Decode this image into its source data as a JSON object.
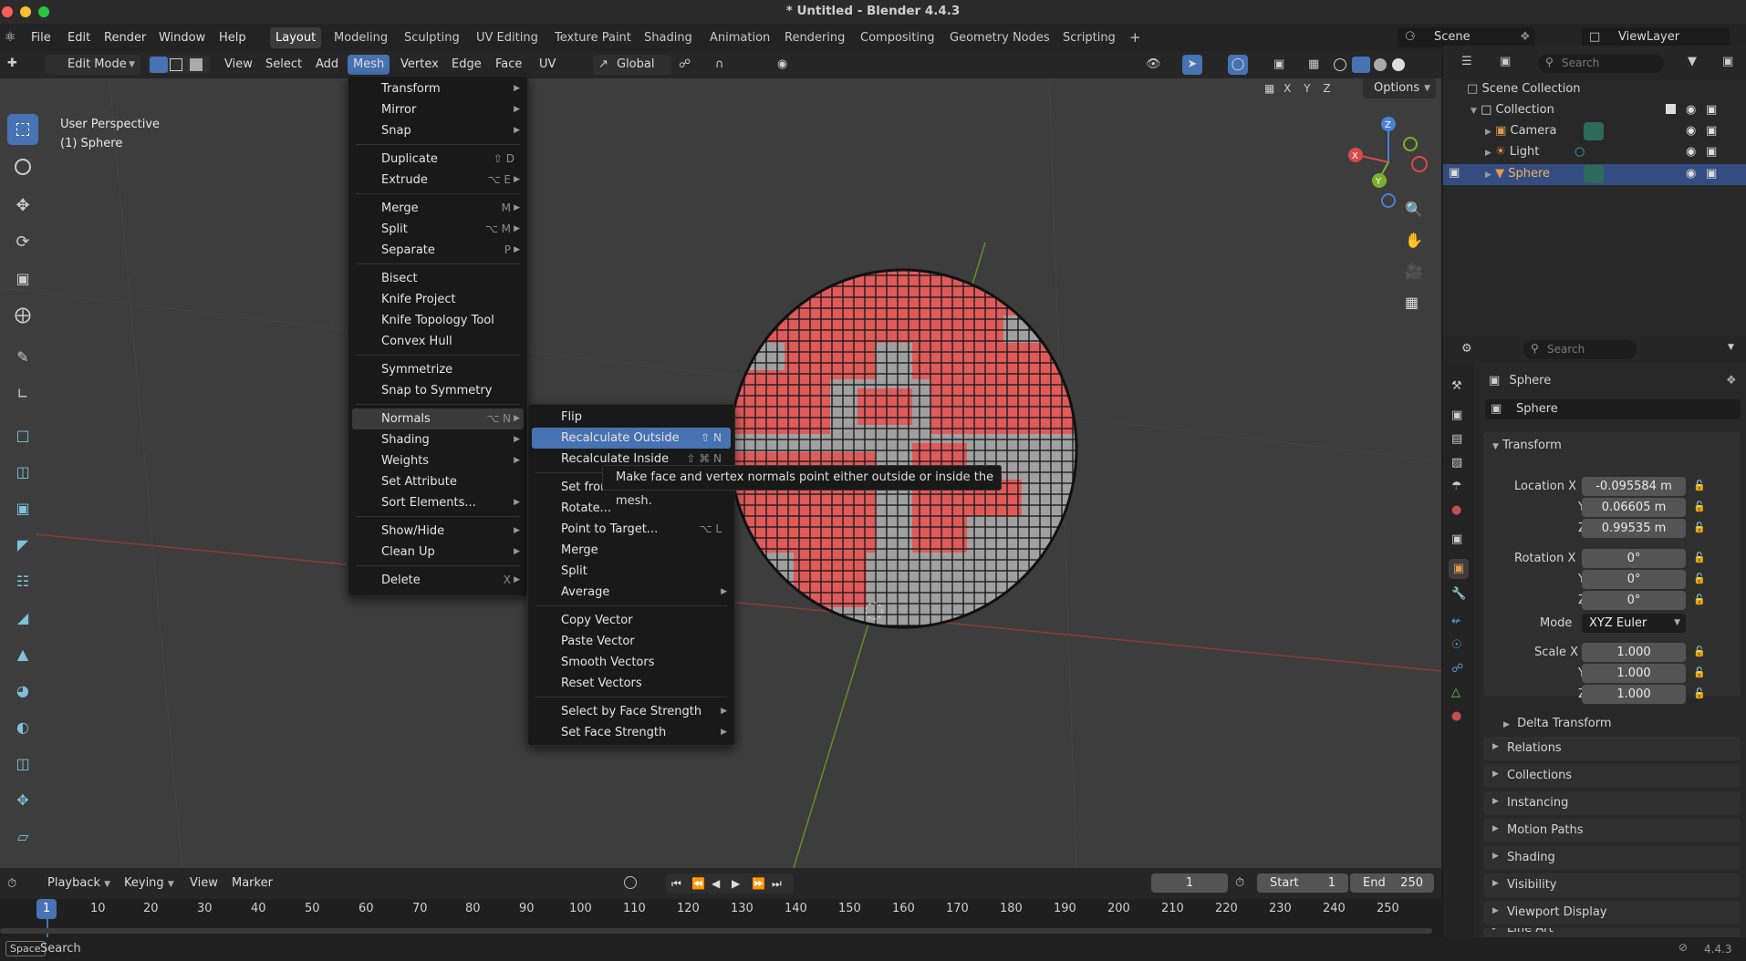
{
  "window": {
    "title": "* Untitled - Blender 4.4.3"
  },
  "menubar": {
    "items": [
      "File",
      "Edit",
      "Render",
      "Window",
      "Help"
    ],
    "workspaces": [
      "Layout",
      "Modeling",
      "Sculpting",
      "UV Editing",
      "Texture Paint",
      "Shading",
      "Animation",
      "Rendering",
      "Compositing",
      "Geometry Nodes",
      "Scripting"
    ],
    "add_tab": "+",
    "scene": "Scene",
    "view_layer": "ViewLayer"
  },
  "viewport_header": {
    "mode": "Edit Mode",
    "menus": [
      "View",
      "Select",
      "Add",
      "Mesh",
      "Vertex",
      "Edge",
      "Face",
      "UV"
    ],
    "orientation": "Global",
    "options": "Options",
    "axes": [
      "X",
      "Y",
      "Z"
    ]
  },
  "viewport": {
    "perspective": "User Perspective",
    "object": "(1) Sphere",
    "gizmo": {
      "z": "Z",
      "y": "Y",
      "x": "X"
    }
  },
  "mesh_menu": {
    "items": [
      {
        "label": "Transform",
        "shortcut": "",
        "sub": true
      },
      {
        "label": "Mirror",
        "shortcut": "",
        "sub": true
      },
      {
        "label": "Snap",
        "shortcut": "",
        "sub": true
      },
      {
        "label": "Duplicate",
        "shortcut": "⇧ D",
        "sub": false
      },
      {
        "label": "Extrude",
        "shortcut": "⌥ E",
        "sub": true
      },
      {
        "label": "Merge",
        "shortcut": "M",
        "sub": true
      },
      {
        "label": "Split",
        "shortcut": "⌥ M",
        "sub": true
      },
      {
        "label": "Separate",
        "shortcut": "P",
        "sub": true
      },
      {
        "label": "Bisect",
        "shortcut": "",
        "sub": false
      },
      {
        "label": "Knife Project",
        "shortcut": "",
        "sub": false
      },
      {
        "label": "Knife Topology Tool",
        "shortcut": "",
        "sub": false
      },
      {
        "label": "Convex Hull",
        "shortcut": "",
        "sub": false
      },
      {
        "label": "Symmetrize",
        "shortcut": "",
        "sub": false
      },
      {
        "label": "Snap to Symmetry",
        "shortcut": "",
        "sub": false
      },
      {
        "label": "Normals",
        "shortcut": "⌥ N",
        "sub": true
      },
      {
        "label": "Shading",
        "shortcut": "",
        "sub": true
      },
      {
        "label": "Weights",
        "shortcut": "",
        "sub": true
      },
      {
        "label": "Set Attribute",
        "shortcut": "",
        "sub": false
      },
      {
        "label": "Sort Elements...",
        "shortcut": "",
        "sub": true
      },
      {
        "label": "Show/Hide",
        "shortcut": "",
        "sub": true
      },
      {
        "label": "Clean Up",
        "shortcut": "",
        "sub": true
      },
      {
        "label": "Delete",
        "shortcut": "X",
        "sub": true
      }
    ]
  },
  "normals_menu": {
    "items": [
      {
        "label": "Flip",
        "shortcut": "",
        "sub": false
      },
      {
        "label": "Recalculate Outside",
        "shortcut": "⇧ N",
        "sub": false
      },
      {
        "label": "Recalculate Inside",
        "shortcut": "⇧ ⌘ N",
        "sub": false
      },
      {
        "label": "Set from Faces",
        "shortcut": "",
        "sub": false
      },
      {
        "label": "Rotate...",
        "shortcut": "",
        "sub": false
      },
      {
        "label": "Point to Target...",
        "shortcut": "⌥ L",
        "sub": false
      },
      {
        "label": "Merge",
        "shortcut": "",
        "sub": false
      },
      {
        "label": "Split",
        "shortcut": "",
        "sub": false
      },
      {
        "label": "Average",
        "shortcut": "",
        "sub": true
      },
      {
        "label": "Copy Vector",
        "shortcut": "",
        "sub": false
      },
      {
        "label": "Paste Vector",
        "shortcut": "",
        "sub": false
      },
      {
        "label": "Smooth Vectors",
        "shortcut": "",
        "sub": false
      },
      {
        "label": "Reset Vectors",
        "shortcut": "",
        "sub": false
      },
      {
        "label": "Select by Face Strength",
        "shortcut": "",
        "sub": true
      },
      {
        "label": "Set Face Strength",
        "shortcut": "",
        "sub": true
      }
    ]
  },
  "tooltip": "Make face and vertex normals point either outside or inside the mesh.",
  "outliner": {
    "search_placeholder": "Search",
    "root": "Scene Collection",
    "collection": "Collection",
    "objects": [
      "Camera",
      "Light",
      "Sphere"
    ]
  },
  "properties": {
    "search_placeholder": "Search",
    "object_name": "Sphere",
    "object_field": "Sphere",
    "transform_label": "Transform",
    "location_label": "Location X",
    "location": [
      "-0.095584 m",
      "0.06605 m",
      "0.99535 m"
    ],
    "rotation_label": "Rotation X",
    "rotation": [
      "0°",
      "0°",
      "0°"
    ],
    "mode_label": "Mode",
    "mode": "XYZ Euler",
    "scale_label": "Scale X",
    "scale": [
      "1.000",
      "1.000",
      "1.000"
    ],
    "axis_y": "Y",
    "axis_z": "Z",
    "panels": [
      "Delta Transform",
      "Relations",
      "Collections",
      "Instancing",
      "Motion Paths",
      "Shading",
      "Visibility",
      "Viewport Display",
      "Line Art"
    ]
  },
  "timeline": {
    "menus": [
      "Playback",
      "Keying",
      "View",
      "Marker"
    ],
    "current_frame": "1",
    "start_label": "Start",
    "start": "1",
    "end_label": "End",
    "end": "250",
    "ticks": [
      "10",
      "20",
      "30",
      "40",
      "50",
      "60",
      "70",
      "80",
      "90",
      "100",
      "110",
      "120",
      "130",
      "140",
      "150",
      "160",
      "170",
      "180",
      "190",
      "200",
      "210",
      "220",
      "230",
      "240",
      "250"
    ],
    "playhead": "1"
  },
  "statusbar": {
    "key": "Space",
    "action": "Search",
    "version": "4.4.3"
  },
  "colors": {
    "accent": "#4772b3",
    "selected_face": "#e05a5a",
    "face": "#9a9a9a",
    "menu_highlight": "#4772b3"
  }
}
